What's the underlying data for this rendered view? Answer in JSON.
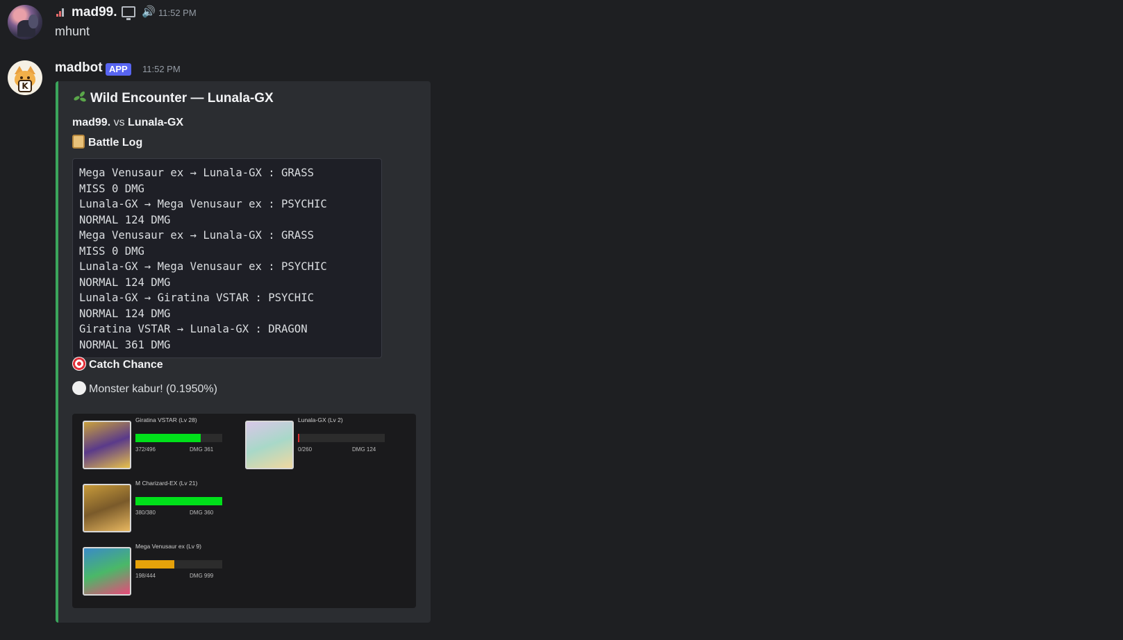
{
  "user_message": {
    "author": "mad99.",
    "time": "11:52 PM",
    "text": "mhunt"
  },
  "bot_message": {
    "author": "madbot",
    "badge": "APP",
    "time": "11:52 PM",
    "embed": {
      "accent_color": "#3ba55c",
      "title": "Wild Encounter — Lunala-GX",
      "vs": {
        "player": "mad99.",
        "sep": "vs",
        "opponent": "Lunala-GX"
      },
      "battle_log_title": "Battle Log",
      "battle_log": [
        "Mega Venusaur ex → Lunala-GX : GRASS",
        "MISS 0 DMG",
        "Lunala-GX → Mega Venusaur ex : PSYCHIC",
        "NORMAL 124 DMG",
        "Mega Venusaur ex → Lunala-GX : GRASS",
        "MISS 0 DMG",
        "Lunala-GX → Mega Venusaur ex : PSYCHIC",
        "NORMAL 124 DMG",
        "Lunala-GX → Giratina VSTAR : PSYCHIC",
        "NORMAL 124 DMG",
        "Giratina VSTAR → Lunala-GX : DRAGON",
        "NORMAL 361 DMG"
      ],
      "catch_title": "Catch Chance",
      "catch_result": "Monster kabur! (0.1950%)",
      "cards": [
        {
          "name": "Giratina VSTAR (Lv 28)",
          "hp": "372/496",
          "dmg": "DMG 361",
          "hp_fraction": 0.75,
          "bar_color": "#00e01a",
          "thumb": [
            "#c9a13c",
            "#5a3a8a",
            "#e8c14a"
          ]
        },
        {
          "name": "Lunala-GX (Lv 2)",
          "hp": "0/260",
          "dmg": "DMG 124",
          "hp_fraction": 0.0,
          "bar_color": "#e03030",
          "thumb": [
            "#d8c7e8",
            "#a8d8c8",
            "#f0d8a0"
          ]
        },
        {
          "name": "M Charizard-EX (Lv 21)",
          "hp": "380/380",
          "dmg": "DMG 360",
          "hp_fraction": 1.0,
          "bar_color": "#00e01a",
          "thumb": [
            "#c79a3a",
            "#7a5a2a",
            "#e8b860"
          ]
        },
        {
          "name": "Mega Venusaur ex (Lv 9)",
          "hp": "198/444",
          "dmg": "DMG 999",
          "hp_fraction": 0.446,
          "bar_color": "#e6a20a",
          "thumb": [
            "#3a8ac8",
            "#4ab868",
            "#e84a7a"
          ]
        }
      ]
    }
  }
}
